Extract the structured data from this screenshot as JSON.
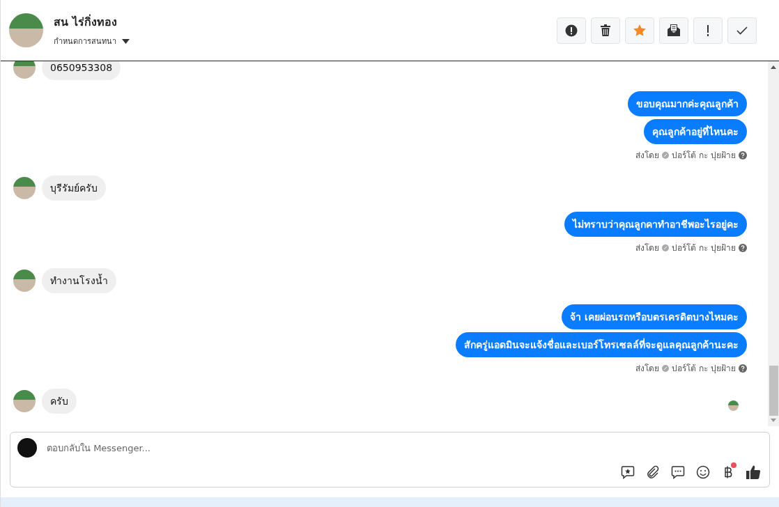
{
  "contact": {
    "name": "สน ไร่กิ่งทอง",
    "subtitle": "กำหนดการสนทนา"
  },
  "toolbar": [
    {
      "kind": "alert"
    },
    {
      "kind": "trash"
    },
    {
      "kind": "star"
    },
    {
      "kind": "mail"
    },
    {
      "kind": "important"
    },
    {
      "kind": "done"
    }
  ],
  "messages": [
    {
      "kind": "incoming",
      "text": "0650953308",
      "seen": false
    },
    {
      "kind": "outgoing",
      "text": "ขอบคุณมากค่ะคุณลูกค้า"
    },
    {
      "kind": "outgoing",
      "text": "คุณลูกค้าอยู่ที่ไหนคะ"
    },
    {
      "kind": "sent_by",
      "label": "ส่งโดย",
      "sender": "ปอร์โต้ กะ ปุยฝ้าย"
    },
    {
      "kind": "incoming",
      "text": "บุรีรัมย์ครับ",
      "seen": false
    },
    {
      "kind": "outgoing",
      "text": "ไม่ทราบว่าคุณลูกคาทำอาชีพอะไรอยู่คะ"
    },
    {
      "kind": "sent_by",
      "label": "ส่งโดย",
      "sender": "ปอร์โต้ กะ ปุยฝ้าย"
    },
    {
      "kind": "incoming",
      "text": "ทำงานโรงน้ำ",
      "seen": false
    },
    {
      "kind": "outgoing",
      "text": "จ้า เคยผ่อนรถหรือบตรเครดิตบางไหมคะ"
    },
    {
      "kind": "outgoing",
      "text": "สักครู่แอดมินจะแจ้งชื่อและเบอร์โทรเซลล์ที่จะดูแลคุณลูกค้านะคะ"
    },
    {
      "kind": "sent_by",
      "label": "ส่งโดย",
      "sender": "ปอร์โต้ กะ ปุยฝ้าย"
    },
    {
      "kind": "incoming",
      "text": "ครับ",
      "seen": true
    }
  ],
  "composer": {
    "placeholder": "ตอบกลับใน Messenger...",
    "tools": [
      {
        "kind": "saved-reply"
      },
      {
        "kind": "attach"
      },
      {
        "kind": "chat"
      },
      {
        "kind": "emoji"
      },
      {
        "kind": "payment",
        "badge": true
      },
      {
        "kind": "like"
      }
    ]
  }
}
